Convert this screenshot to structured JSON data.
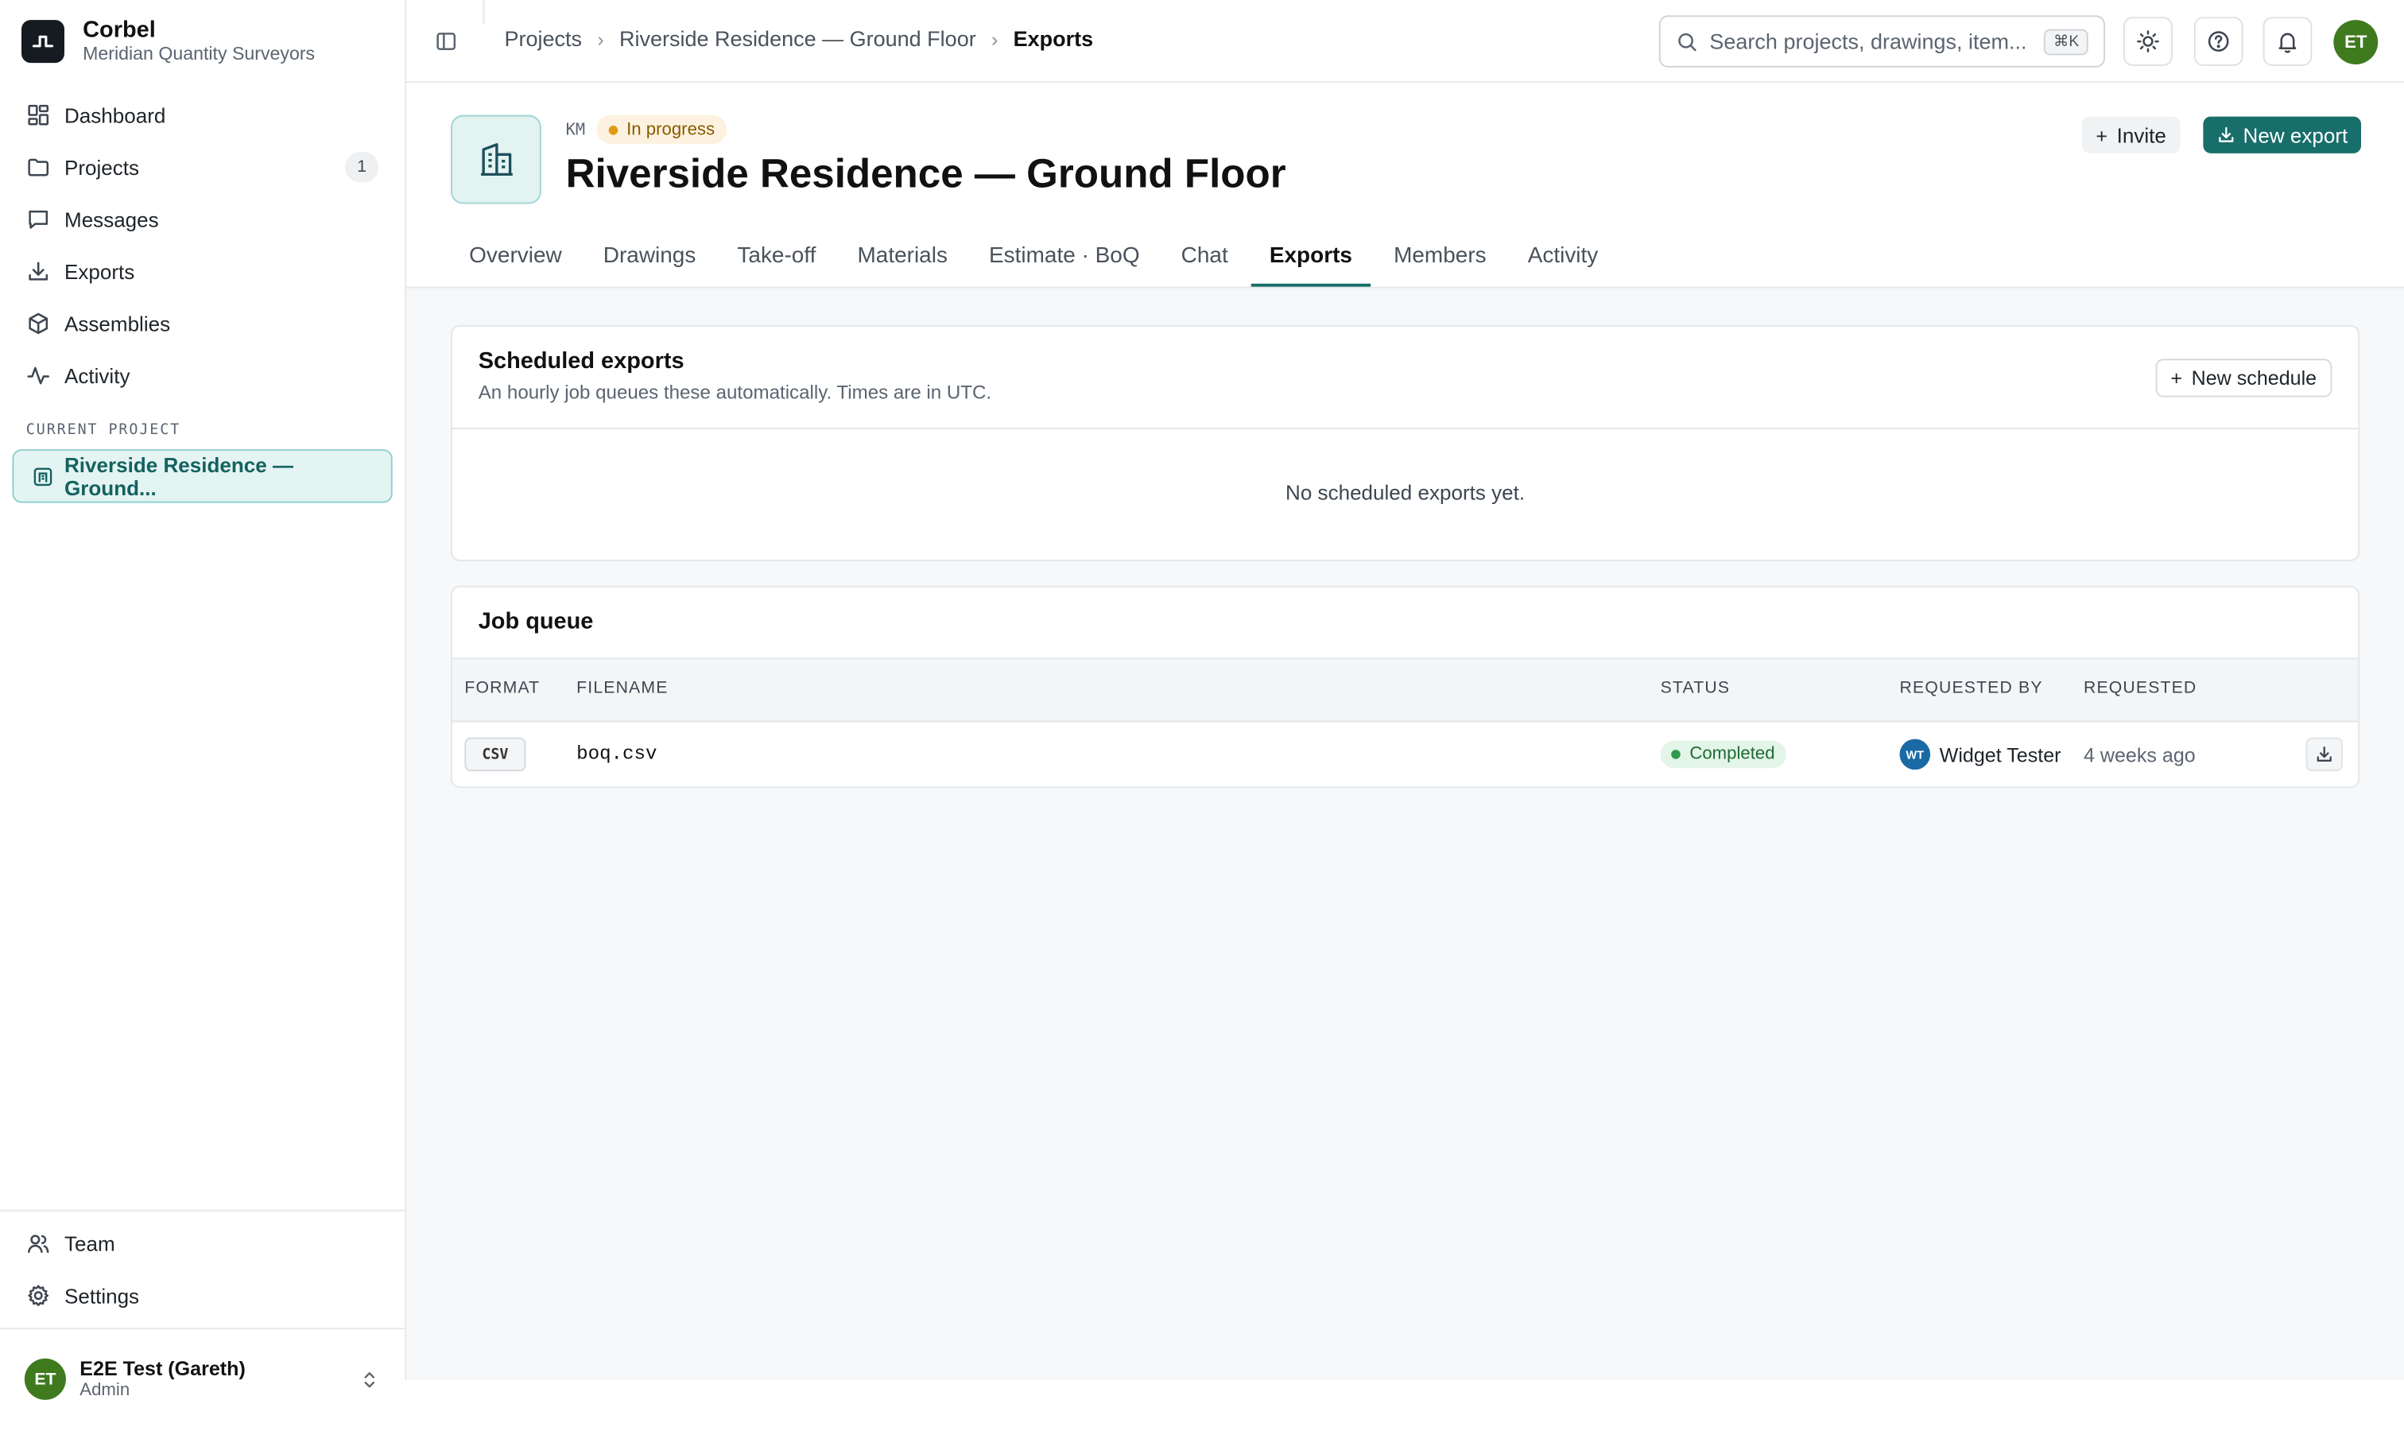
{
  "brand": {
    "name": "Corbel",
    "org": "Meridian Quantity Surveyors"
  },
  "sidebar": {
    "items": [
      {
        "label": "Dashboard",
        "icon": "dashboard-icon"
      },
      {
        "label": "Projects",
        "icon": "folder-icon",
        "badge": "1"
      },
      {
        "label": "Messages",
        "icon": "message-icon"
      },
      {
        "label": "Exports",
        "icon": "download-icon"
      },
      {
        "label": "Assemblies",
        "icon": "box-icon"
      },
      {
        "label": "Activity",
        "icon": "activity-icon"
      }
    ],
    "current_project_label": "CURRENT PROJECT",
    "current_project": "Riverside Residence — Ground...",
    "bottom_items": [
      {
        "label": "Team",
        "icon": "users-icon"
      },
      {
        "label": "Settings",
        "icon": "gear-icon"
      }
    ],
    "user": {
      "initials": "ET",
      "name": "E2E Test (Gareth)",
      "role": "Admin"
    }
  },
  "topbar": {
    "breadcrumb": [
      "Projects",
      "Riverside Residence — Ground Floor",
      "Exports"
    ],
    "search_placeholder": "Search projects, drawings, item...",
    "search_shortcut": "⌘K",
    "avatar_initials": "ET"
  },
  "project": {
    "code": "KM",
    "status": "In progress",
    "title": "Riverside Residence — Ground Floor",
    "invite_label": "Invite",
    "new_export_label": "New export",
    "tabs": [
      "Overview",
      "Drawings",
      "Take-off",
      "Materials",
      "Estimate · BoQ",
      "Chat",
      "Exports",
      "Members",
      "Activity"
    ],
    "active_tab": "Exports"
  },
  "scheduled": {
    "title": "Scheduled exports",
    "description": "An hourly job queues these automatically. Times are in UTC.",
    "new_label": "New schedule",
    "empty_text": "No scheduled exports yet."
  },
  "jobs": {
    "title": "Job queue",
    "columns": [
      "FORMAT",
      "FILENAME",
      "STATUS",
      "REQUESTED BY",
      "REQUESTED"
    ],
    "rows": [
      {
        "format": "CSV",
        "filename": "boq.csv",
        "status": "Completed",
        "requester_initials": "WT",
        "requester": "Widget Tester",
        "requested": "4 weeks ago"
      }
    ]
  },
  "colors": {
    "accent": "#176e6a",
    "status_progress": "#e29a12",
    "status_completed": "#2f9a4e",
    "avatar": "#3f7a1f"
  }
}
